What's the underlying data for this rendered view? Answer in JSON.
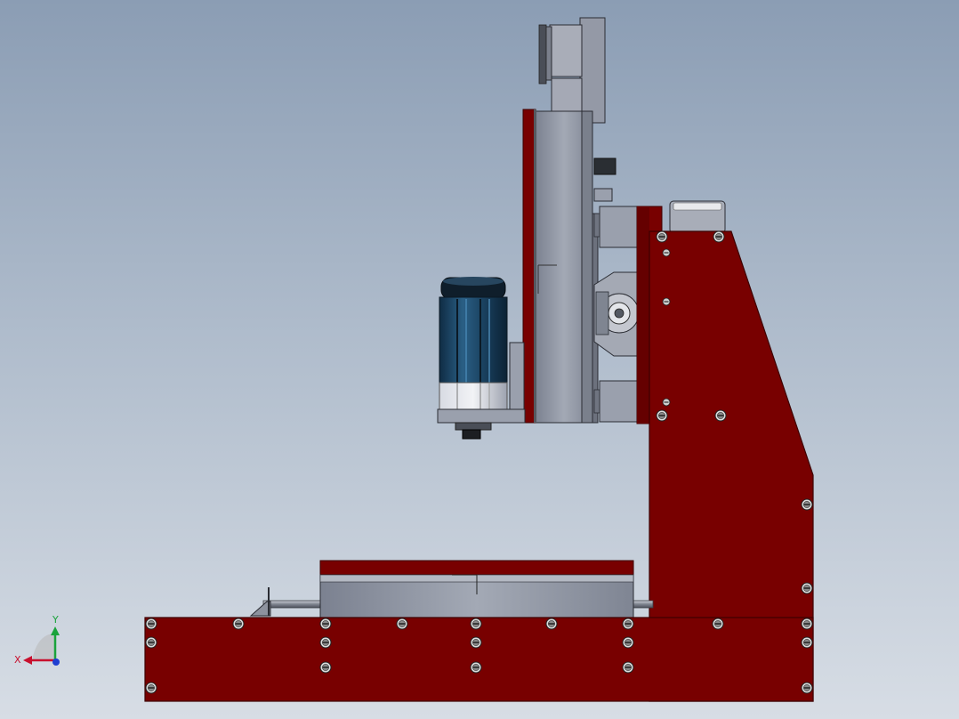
{
  "colors": {
    "frame_red": "#780000",
    "frame_red_edge": "#3c0000",
    "steel_gray": "#8f95a3",
    "steel_light": "#a4aab6",
    "steel_dark": "#5d6270",
    "motor_blue": "#1b4565",
    "motor_dark": "#0f1e2b",
    "screw_face": "#d8d8d8",
    "axis_x": "#c8102e",
    "axis_y": "#1aa33b",
    "axis_z": "#1f3fd1"
  },
  "triad": {
    "x_label": "X",
    "y_label": "Y"
  }
}
